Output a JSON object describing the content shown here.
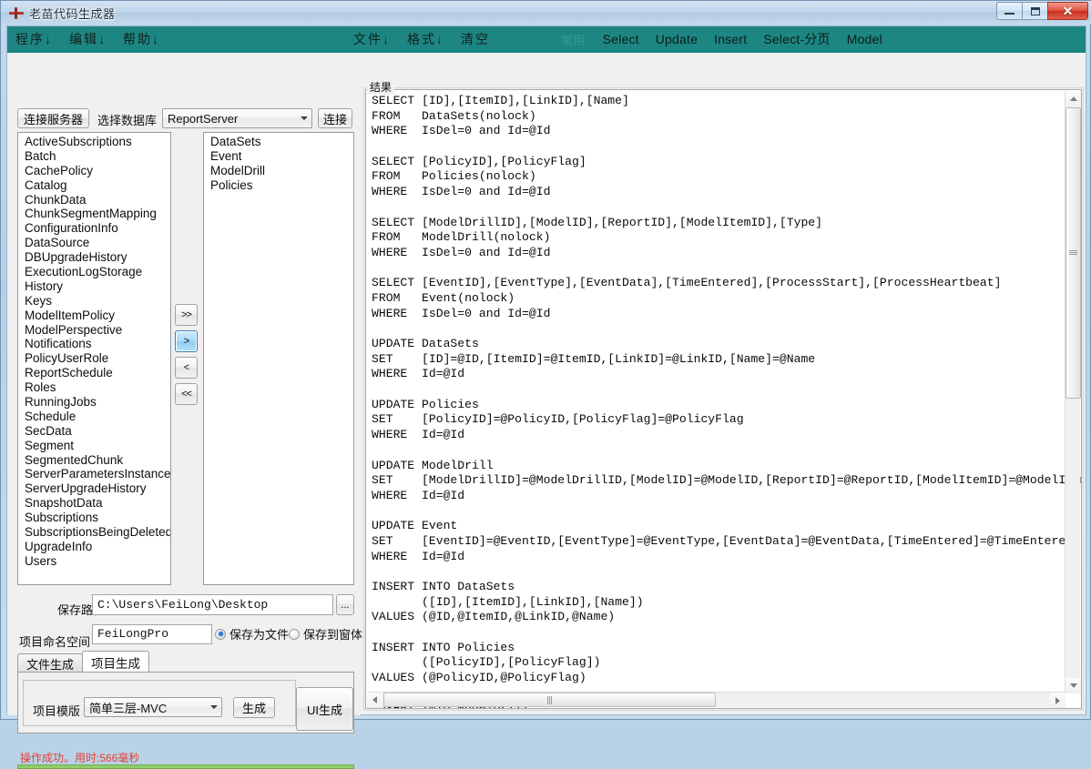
{
  "window": {
    "title": "老苗代码生成器",
    "icon": "plus-cross-icon",
    "buttons": {
      "minimize": "minimize-icon",
      "maximize": "maximize-icon",
      "close": "✕"
    }
  },
  "menubar": {
    "left_items": [
      "程序↓",
      "编辑↓",
      "帮助↓"
    ],
    "mid_items": [
      "文件↓",
      "格式↓",
      "清空"
    ],
    "common_label": "常用:",
    "right_items": [
      "Select",
      "Update",
      "Insert",
      "Select-分页",
      "Model"
    ],
    "background_color": "#1d8682"
  },
  "toolbar": {
    "connect_server_label": "连接服务器",
    "select_db_label": "选择数据库",
    "database_value": "ReportServer",
    "database_options": [
      "ReportServer"
    ],
    "connect_label": "连接"
  },
  "lists": {
    "available": [
      "ActiveSubscriptions",
      "Batch",
      "CachePolicy",
      "Catalog",
      "ChunkData",
      "ChunkSegmentMapping",
      "ConfigurationInfo",
      "DataSource",
      "DBUpgradeHistory",
      "ExecutionLogStorage",
      "History",
      "Keys",
      "ModelItemPolicy",
      "ModelPerspective",
      "Notifications",
      "PolicyUserRole",
      "ReportSchedule",
      "Roles",
      "RunningJobs",
      "Schedule",
      "SecData",
      "Segment",
      "SegmentedChunk",
      "ServerParametersInstance",
      "ServerUpgradeHistory",
      "SnapshotData",
      "Subscriptions",
      "SubscriptionsBeingDeleted",
      "UpgradeInfo",
      "Users"
    ],
    "selected": [
      "DataSets",
      "Event",
      "ModelDrill",
      "Policies"
    ]
  },
  "transfer_buttons": {
    "all_right": ">>",
    "right": ">",
    "left": "<",
    "all_left": "<<"
  },
  "save": {
    "path_label": "保存路径",
    "path_value": "C:\\Users\\FeiLong\\Desktop",
    "browse_label": "...",
    "namespace_label": "项目命名空间",
    "namespace_value": "FeiLongPro",
    "radio_file_label": "保存为文件",
    "radio_form_label": "保存到窗体",
    "radio_selected": "file"
  },
  "tabs": [
    {
      "label": "文件生成",
      "active": false
    },
    {
      "label": "项目生成",
      "active": true
    }
  ],
  "project_panel": {
    "template_label": "项目模版",
    "template_value": "简单三层-MVC",
    "template_options": [
      "简单三层-MVC"
    ],
    "generate_label": "生成",
    "ui_generate_label": "UI生成"
  },
  "status": {
    "text": "操作成功。用时:566毫秒",
    "color": "#e34234",
    "progress_color": "#8fce6a"
  },
  "result": {
    "legend": "结果",
    "code": "SELECT [ID],[ItemID],[LinkID],[Name]\nFROM   DataSets(nolock)\nWHERE  IsDel=0 and Id=@Id\n\nSELECT [PolicyID],[PolicyFlag]\nFROM   Policies(nolock)\nWHERE  IsDel=0 and Id=@Id\n\nSELECT [ModelDrillID],[ModelID],[ReportID],[ModelItemID],[Type]\nFROM   ModelDrill(nolock)\nWHERE  IsDel=0 and Id=@Id\n\nSELECT [EventID],[EventType],[EventData],[TimeEntered],[ProcessStart],[ProcessHeartbeat]\nFROM   Event(nolock)\nWHERE  IsDel=0 and Id=@Id\n\nUPDATE DataSets\nSET    [ID]=@ID,[ItemID]=@ItemID,[LinkID]=@LinkID,[Name]=@Name\nWHERE  Id=@Id\n\nUPDATE Policies\nSET    [PolicyID]=@PolicyID,[PolicyFlag]=@PolicyFlag\nWHERE  Id=@Id\n\nUPDATE ModelDrill\nSET    [ModelDrillID]=@ModelDrillID,[ModelID]=@ModelID,[ReportID]=@ReportID,[ModelItemID]=@ModelItemID\nWHERE  Id=@Id\n\nUPDATE Event\nSET    [EventID]=@EventID,[EventType]=@EventType,[EventData]=@EventData,[TimeEntered]=@TimeEntered\nWHERE  Id=@Id\n\nINSERT INTO DataSets\n       ([ID],[ItemID],[LinkID],[Name])\nVALUES (@ID,@ItemID,@LinkID,@Name)\n\nINSERT INTO Policies\n       ([PolicyID],[PolicyFlag])\nVALUES (@PolicyID,@PolicyFlag)\n\nINSERT INTO ModelDrill\n       ([ModelDrillID],[ModelID],[ReportID],[ModelItemID],[Type])"
  }
}
